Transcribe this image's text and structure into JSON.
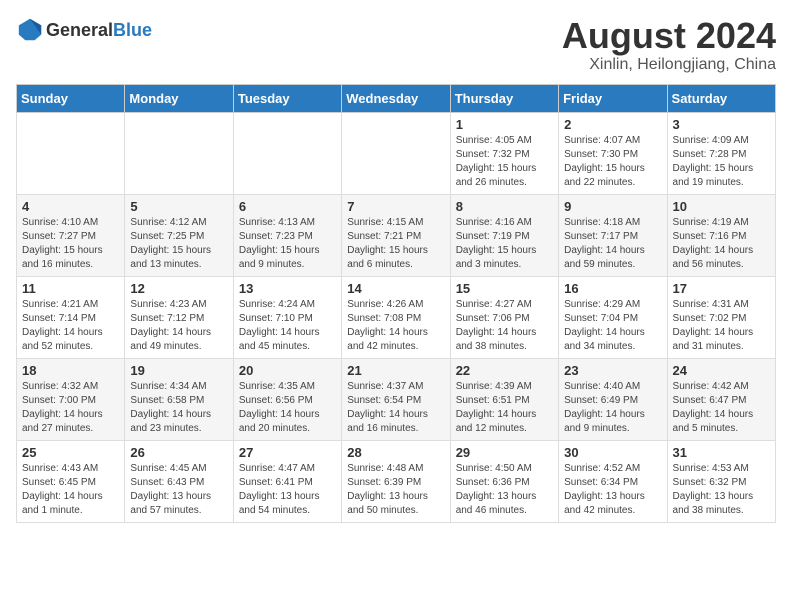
{
  "header": {
    "logo_general": "General",
    "logo_blue": "Blue",
    "month_year": "August 2024",
    "location": "Xinlin, Heilongjiang, China"
  },
  "weekdays": [
    "Sunday",
    "Monday",
    "Tuesday",
    "Wednesday",
    "Thursday",
    "Friday",
    "Saturday"
  ],
  "weeks": [
    [
      {
        "day": "",
        "info": ""
      },
      {
        "day": "",
        "info": ""
      },
      {
        "day": "",
        "info": ""
      },
      {
        "day": "",
        "info": ""
      },
      {
        "day": "1",
        "info": "Sunrise: 4:05 AM\nSunset: 7:32 PM\nDaylight: 15 hours\nand 26 minutes."
      },
      {
        "day": "2",
        "info": "Sunrise: 4:07 AM\nSunset: 7:30 PM\nDaylight: 15 hours\nand 22 minutes."
      },
      {
        "day": "3",
        "info": "Sunrise: 4:09 AM\nSunset: 7:28 PM\nDaylight: 15 hours\nand 19 minutes."
      }
    ],
    [
      {
        "day": "4",
        "info": "Sunrise: 4:10 AM\nSunset: 7:27 PM\nDaylight: 15 hours\nand 16 minutes."
      },
      {
        "day": "5",
        "info": "Sunrise: 4:12 AM\nSunset: 7:25 PM\nDaylight: 15 hours\nand 13 minutes."
      },
      {
        "day": "6",
        "info": "Sunrise: 4:13 AM\nSunset: 7:23 PM\nDaylight: 15 hours\nand 9 minutes."
      },
      {
        "day": "7",
        "info": "Sunrise: 4:15 AM\nSunset: 7:21 PM\nDaylight: 15 hours\nand 6 minutes."
      },
      {
        "day": "8",
        "info": "Sunrise: 4:16 AM\nSunset: 7:19 PM\nDaylight: 15 hours\nand 3 minutes."
      },
      {
        "day": "9",
        "info": "Sunrise: 4:18 AM\nSunset: 7:17 PM\nDaylight: 14 hours\nand 59 minutes."
      },
      {
        "day": "10",
        "info": "Sunrise: 4:19 AM\nSunset: 7:16 PM\nDaylight: 14 hours\nand 56 minutes."
      }
    ],
    [
      {
        "day": "11",
        "info": "Sunrise: 4:21 AM\nSunset: 7:14 PM\nDaylight: 14 hours\nand 52 minutes."
      },
      {
        "day": "12",
        "info": "Sunrise: 4:23 AM\nSunset: 7:12 PM\nDaylight: 14 hours\nand 49 minutes."
      },
      {
        "day": "13",
        "info": "Sunrise: 4:24 AM\nSunset: 7:10 PM\nDaylight: 14 hours\nand 45 minutes."
      },
      {
        "day": "14",
        "info": "Sunrise: 4:26 AM\nSunset: 7:08 PM\nDaylight: 14 hours\nand 42 minutes."
      },
      {
        "day": "15",
        "info": "Sunrise: 4:27 AM\nSunset: 7:06 PM\nDaylight: 14 hours\nand 38 minutes."
      },
      {
        "day": "16",
        "info": "Sunrise: 4:29 AM\nSunset: 7:04 PM\nDaylight: 14 hours\nand 34 minutes."
      },
      {
        "day": "17",
        "info": "Sunrise: 4:31 AM\nSunset: 7:02 PM\nDaylight: 14 hours\nand 31 minutes."
      }
    ],
    [
      {
        "day": "18",
        "info": "Sunrise: 4:32 AM\nSunset: 7:00 PM\nDaylight: 14 hours\nand 27 minutes."
      },
      {
        "day": "19",
        "info": "Sunrise: 4:34 AM\nSunset: 6:58 PM\nDaylight: 14 hours\nand 23 minutes."
      },
      {
        "day": "20",
        "info": "Sunrise: 4:35 AM\nSunset: 6:56 PM\nDaylight: 14 hours\nand 20 minutes."
      },
      {
        "day": "21",
        "info": "Sunrise: 4:37 AM\nSunset: 6:54 PM\nDaylight: 14 hours\nand 16 minutes."
      },
      {
        "day": "22",
        "info": "Sunrise: 4:39 AM\nSunset: 6:51 PM\nDaylight: 14 hours\nand 12 minutes."
      },
      {
        "day": "23",
        "info": "Sunrise: 4:40 AM\nSunset: 6:49 PM\nDaylight: 14 hours\nand 9 minutes."
      },
      {
        "day": "24",
        "info": "Sunrise: 4:42 AM\nSunset: 6:47 PM\nDaylight: 14 hours\nand 5 minutes."
      }
    ],
    [
      {
        "day": "25",
        "info": "Sunrise: 4:43 AM\nSunset: 6:45 PM\nDaylight: 14 hours\nand 1 minute."
      },
      {
        "day": "26",
        "info": "Sunrise: 4:45 AM\nSunset: 6:43 PM\nDaylight: 13 hours\nand 57 minutes."
      },
      {
        "day": "27",
        "info": "Sunrise: 4:47 AM\nSunset: 6:41 PM\nDaylight: 13 hours\nand 54 minutes."
      },
      {
        "day": "28",
        "info": "Sunrise: 4:48 AM\nSunset: 6:39 PM\nDaylight: 13 hours\nand 50 minutes."
      },
      {
        "day": "29",
        "info": "Sunrise: 4:50 AM\nSunset: 6:36 PM\nDaylight: 13 hours\nand 46 minutes."
      },
      {
        "day": "30",
        "info": "Sunrise: 4:52 AM\nSunset: 6:34 PM\nDaylight: 13 hours\nand 42 minutes."
      },
      {
        "day": "31",
        "info": "Sunrise: 4:53 AM\nSunset: 6:32 PM\nDaylight: 13 hours\nand 38 minutes."
      }
    ]
  ]
}
